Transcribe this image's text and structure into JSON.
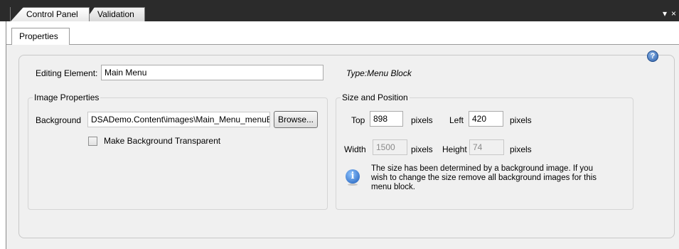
{
  "tabs": {
    "control_panel": "Control Panel",
    "validation": "Validation"
  },
  "window_buttons": {
    "dropdown": "▾",
    "close": "×"
  },
  "inner_tab": "Properties",
  "editing": {
    "label": "Editing Element:",
    "value": "Main Menu",
    "type_text": "Type:Menu Block"
  },
  "image_properties": {
    "title": "Image Properties",
    "background_label": "Background",
    "background_value": "DSADemo.Content\\images\\Main_Menu_menuB",
    "browse_label": "Browse...",
    "transparent_label": "Make Background Transparent",
    "transparent_checked": false
  },
  "size_position": {
    "title": "Size and Position",
    "top_label": "Top",
    "top_value": "898",
    "left_label": "Left",
    "left_value": "420",
    "width_label": "Width",
    "width_value": "1500",
    "height_label": "Height",
    "height_value": "74",
    "pixels_label": "pixels",
    "info_text": "The size has been determined by a background image.  If you wish to change the size remove all background images for this menu block."
  },
  "icons": {
    "help": "help-icon",
    "info": "info-icon"
  },
  "colors": {
    "titlebar": "#2b2b2b",
    "panel": "#f0f0f0",
    "icon_blue": "#2c5fa8"
  }
}
